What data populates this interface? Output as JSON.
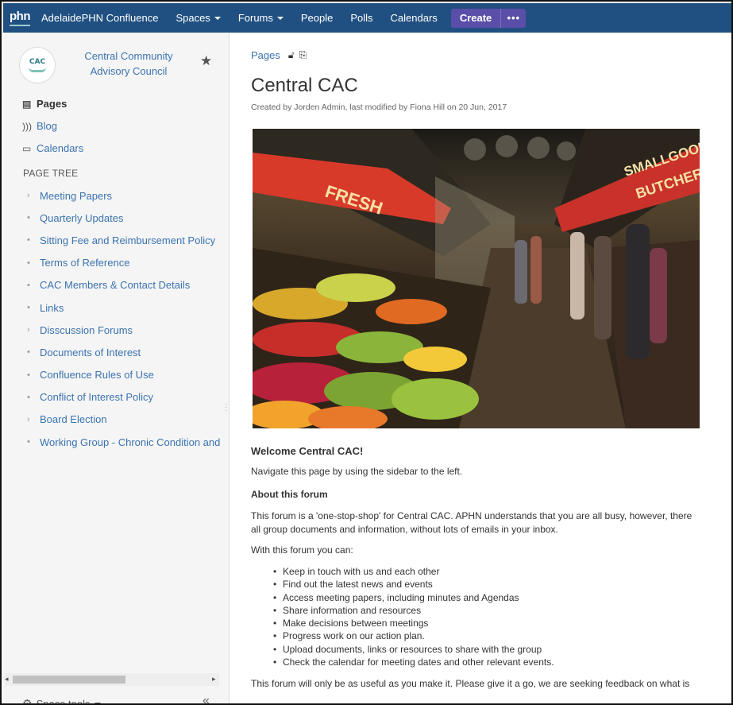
{
  "topbar": {
    "logo_text": "phn",
    "product_name": "AdelaidePHN Confluence",
    "nav": [
      {
        "label": "Spaces",
        "dropdown": true
      },
      {
        "label": "Forums",
        "dropdown": true
      },
      {
        "label": "People",
        "dropdown": false
      },
      {
        "label": "Polls",
        "dropdown": false
      },
      {
        "label": "Calendars",
        "dropdown": false
      }
    ],
    "create_label": "Create",
    "more_label": "•••",
    "bar_color": "#205081",
    "create_color": "#5a4ea8"
  },
  "sidebar": {
    "avatar_text": "CAC",
    "space_name": "Central Community Advisory Council",
    "links": {
      "pages": "Pages",
      "blog": "Blog",
      "calendars": "Calendars"
    },
    "tree_title": "PAGE TREE",
    "tree": [
      {
        "label": "Meeting Papers",
        "marker": "›"
      },
      {
        "label": "Quarterly Updates",
        "marker": "•"
      },
      {
        "label": "Sitting Fee and Reimbursement Policy",
        "marker": "•"
      },
      {
        "label": "Terms of Reference",
        "marker": "•"
      },
      {
        "label": "CAC Members & Contact Details",
        "marker": "•"
      },
      {
        "label": "Links",
        "marker": "•"
      },
      {
        "label": "Disscussion Forums",
        "marker": "›"
      },
      {
        "label": "Documents of Interest",
        "marker": "•"
      },
      {
        "label": "Confluence Rules of Use",
        "marker": "•"
      },
      {
        "label": "Conflict of Interest Policy",
        "marker": "•"
      },
      {
        "label": "Board Election",
        "marker": "›"
      },
      {
        "label": "Working Group - Chronic Condition and",
        "marker": "•"
      }
    ],
    "space_tools": "Space tools",
    "collapse": "«"
  },
  "page": {
    "breadcrumb": "Pages",
    "title": "Central CAC",
    "byline": "Created by Jorden Admin, last modified by Fiona Hill on 20 Jun, 2017",
    "welcome": "Welcome Central CAC!",
    "navigate": "Navigate this page by using the sidebar to the left.",
    "about_heading": "About this forum",
    "intro_line1": "This forum is a 'one-stop-shop' for Central CAC. APHN understands that you are all busy, however, there",
    "intro_line2": "all group documents and information, without lots of emails in your inbox.",
    "can_intro": "With this forum you can:",
    "bullets": [
      "Keep in touch with us and each other",
      "Find out the latest news and events",
      "Access meeting papers, including minutes and Agendas",
      "Share information and resources",
      "Make decisions between meetings",
      "Progress work on our action plan.",
      "Upload documents, links or resources to share with the group",
      "Check the calendar for meeting dates and other relevant events."
    ],
    "closing": "This forum will only be as useful as you make it. Please give it a go, we are seeking feedback on what is",
    "hero_signs": {
      "fresh": "FRESH",
      "smallgoods": "SMALLGOODS",
      "butchers": "BUTCHERS"
    }
  }
}
